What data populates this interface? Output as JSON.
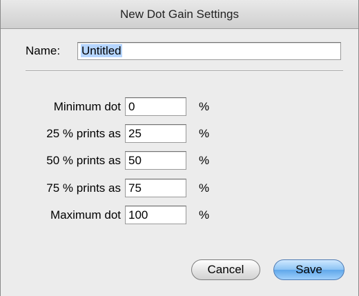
{
  "window": {
    "title": "New Dot Gain Settings"
  },
  "name_field": {
    "label": "Name:",
    "value": "Untitled"
  },
  "settings": [
    {
      "label": "Minimum dot",
      "value": "0",
      "unit": "%"
    },
    {
      "label": "25 % prints as",
      "value": "25",
      "unit": "%"
    },
    {
      "label": "50 % prints as",
      "value": "50",
      "unit": "%"
    },
    {
      "label": "75 % prints as",
      "value": "75",
      "unit": "%"
    },
    {
      "label": "Maximum dot",
      "value": "100",
      "unit": "%"
    }
  ],
  "buttons": {
    "cancel": "Cancel",
    "save": "Save"
  },
  "colors": {
    "window_bg": "#ececec",
    "selection": "#b5d5ff",
    "default_button": "#5fa7ea"
  }
}
